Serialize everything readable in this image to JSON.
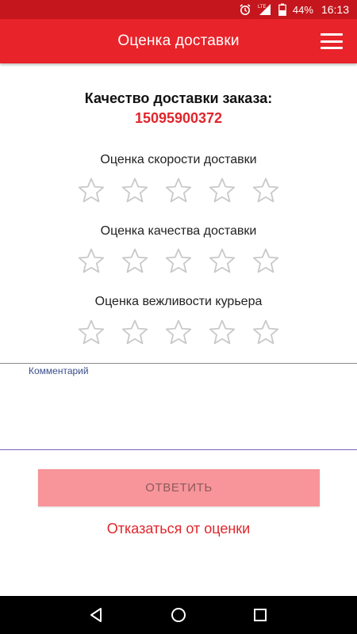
{
  "colors": {
    "status_bar": "#c4161c",
    "app_bar": "#e8232a",
    "accent_red": "#e0262c",
    "button_disabled": "#f7959a",
    "star_outline": "#c9c9c9"
  },
  "status_bar": {
    "icons": [
      "alarm-icon",
      "lte-signal-icon",
      "battery-icon"
    ],
    "lte_label": "LTE",
    "battery": "44%",
    "time": "16:13"
  },
  "app_bar": {
    "title": "Оценка доставки",
    "menu_icon": "hamburger-menu-icon"
  },
  "order": {
    "heading": "Качество доставки заказа:",
    "number": "15095900372"
  },
  "ratings": [
    {
      "label": "Оценка скорости доставки",
      "value": 0,
      "max": 5
    },
    {
      "label": "Оценка качества доставки",
      "value": 0,
      "max": 5
    },
    {
      "label": "Оценка вежливости курьера",
      "value": 0,
      "max": 5
    }
  ],
  "comment": {
    "label": "Комментарий",
    "value": ""
  },
  "actions": {
    "reply_label": "ОТВЕТИТЬ",
    "decline_label": "Отказаться от оценки"
  },
  "nav_bar": {
    "icons": [
      "back-icon",
      "home-icon",
      "recents-icon"
    ]
  }
}
